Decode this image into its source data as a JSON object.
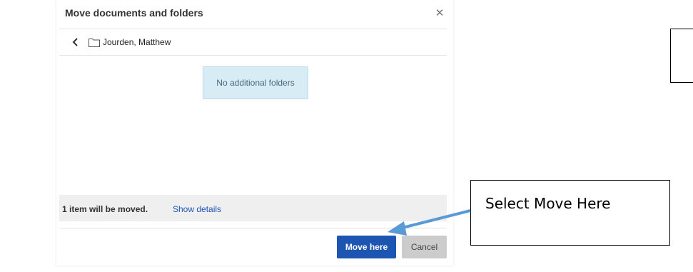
{
  "dialog": {
    "title": "Move documents and folders",
    "close_icon": "close-icon",
    "current_folder": "Jourden, Matthew",
    "back_icon": "chevron-left-icon",
    "folder_icon": "folder-icon",
    "empty_message": "No additional folders",
    "status": {
      "count_text": "1 item will be moved.",
      "details_link": "Show details"
    },
    "buttons": {
      "move_here": "Move here",
      "cancel": "Cancel"
    }
  },
  "annotation": {
    "callout_text": "Select Move Here",
    "arrow_color": "#5b9bd5"
  },
  "colors": {
    "primary_button": "#1d55b3",
    "link": "#1f57b5",
    "empty_box_bg": "#d7ecf5"
  }
}
